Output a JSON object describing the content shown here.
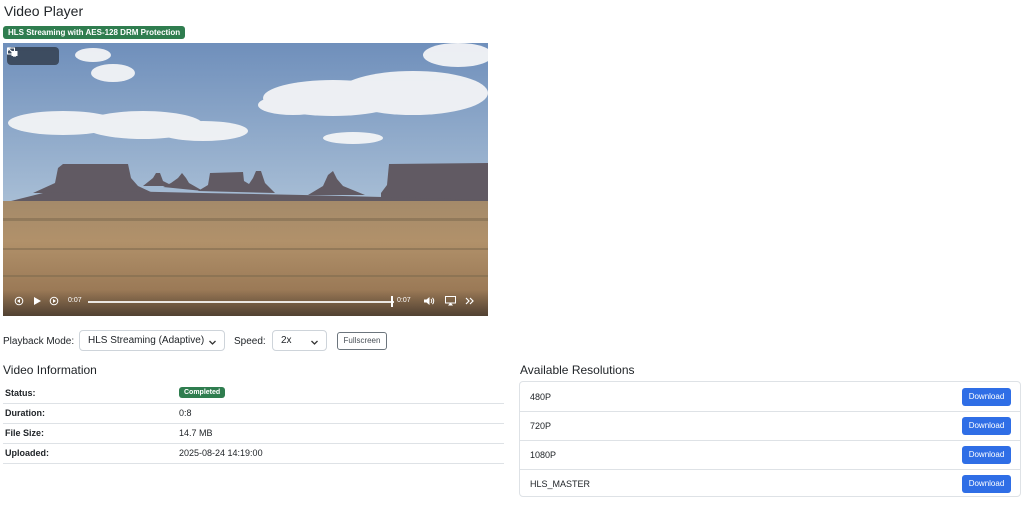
{
  "page": {
    "title": "Video Player",
    "badge": "HLS Streaming with AES-128 DRM Protection"
  },
  "player": {
    "current_time": "0:07",
    "end_time": "0:07",
    "progress": 0.99,
    "top_icons": [
      "expand-icon",
      "pip-icon"
    ],
    "bottom_icons": [
      "rewind-icon",
      "play-icon",
      "forward-icon",
      "volume-icon",
      "airplay-icon",
      "more-icon"
    ]
  },
  "controls": {
    "playback_label": "Playback Mode:",
    "playback_value": "HLS Streaming (Adaptive)",
    "speed_label": "Speed:",
    "speed_value": "2x",
    "fullscreen_label": "Fullscreen"
  },
  "info": {
    "title": "Video Information",
    "rows": [
      {
        "key": "Status:",
        "value": "Completed"
      },
      {
        "key": "Duration:",
        "value": "0:8"
      },
      {
        "key": "File Size:",
        "value": "14.7 MB"
      },
      {
        "key": "Uploaded:",
        "value": "2025-08-24 14:19:00"
      }
    ]
  },
  "resolutions": {
    "title": "Available Resolutions",
    "download_label": "Download",
    "items": [
      {
        "name": "480P"
      },
      {
        "name": "720P"
      },
      {
        "name": "1080P"
      },
      {
        "name": "HLS_MASTER"
      }
    ]
  },
  "colors": {
    "success": "#2f7d4f",
    "primary": "#2f6ee6"
  }
}
